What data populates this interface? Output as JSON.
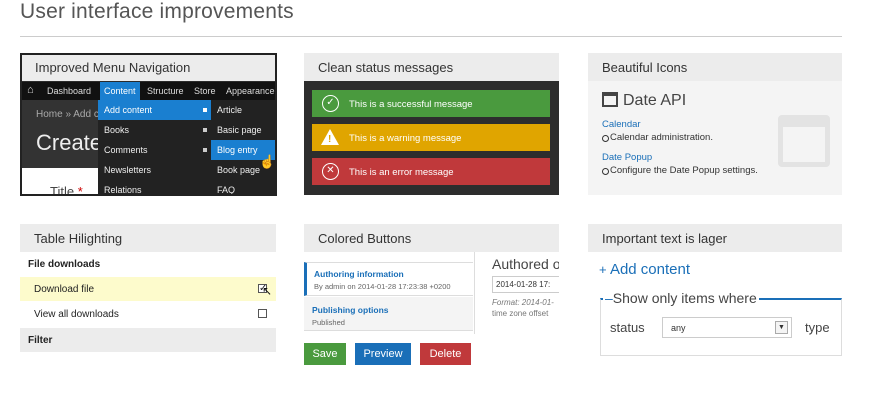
{
  "page_title": "User interface improvements",
  "menu_panel": {
    "title": "Improved Menu Navigation",
    "home_icon": "home-icon",
    "topbar": [
      "Dashboard",
      "Content",
      "Structure",
      "Store",
      "Appearance"
    ],
    "breadcrumb": "Home » Add c",
    "big_heading": "Create",
    "title_label": "Title",
    "required_mark": "*",
    "content_menu": [
      "Add content",
      "Books",
      "Comments",
      "Newsletters",
      "Relations"
    ],
    "add_content_menu": [
      "Article",
      "Basic page",
      "Blog entry",
      "Book page",
      "FAQ"
    ]
  },
  "status_panel": {
    "title": "Clean status messages",
    "success": "This is a successful message",
    "warning": "This is a warning message",
    "error": "This is an error message",
    "colors": {
      "success": "#4a9a3e",
      "warning": "#e0a500",
      "error": "#c0393b"
    }
  },
  "icons_panel": {
    "title": "Beautiful Icons",
    "heading": "Date API",
    "link1": "Calendar",
    "desc1": "Calendar administration.",
    "link2": "Date Popup",
    "desc2": "Configure the Date Popup settings."
  },
  "table_panel": {
    "title": "Table Hilighting",
    "header": "File downloads",
    "row1": "Download file",
    "row1_checked": true,
    "row2": "View all downloads",
    "row2_checked": false,
    "footer": "Filter",
    "highlight_color": "#fdfbcc"
  },
  "buttons_panel": {
    "title": "Colored Buttons",
    "tab1_title": "Authoring information",
    "tab1_sub": "By admin on 2014-01-28 17:23:38 +0200",
    "tab2_title": "Publishing options",
    "tab2_sub": "Published",
    "authored_label": "Authored o",
    "date_value": "2014-01-28 17:",
    "format_text": "Format: 2014-01-",
    "tz_text": "time zone offset",
    "save": "Save",
    "preview": "Preview",
    "delete": "Delete",
    "colors": {
      "save": "#4a9a3e",
      "preview": "#1a6fb8",
      "delete": "#c0393b"
    }
  },
  "important_panel": {
    "title": "Important text is lager",
    "add_content": "Add content",
    "fieldset_legend": "Show only items where",
    "status_label": "status",
    "status_value": "any",
    "type_label": "type"
  }
}
